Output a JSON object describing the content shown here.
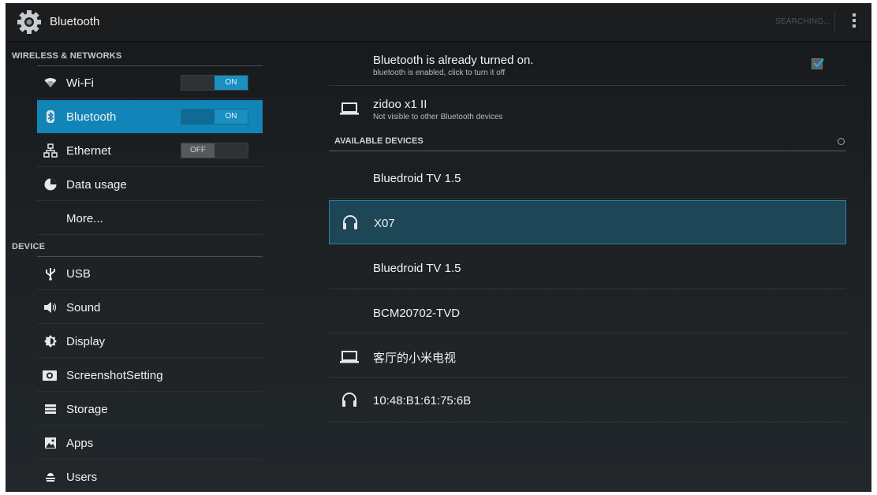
{
  "app": {
    "title": "Bluetooth"
  },
  "actionbar": {
    "status": "SEARCHING..."
  },
  "left": {
    "wireless_header": "WIRELESS & NETWORKS",
    "device_header": "DEVICE",
    "wifi": {
      "label": "Wi-Fi",
      "toggle": "ON"
    },
    "bluetooth": {
      "label": "Bluetooth",
      "toggle": "ON"
    },
    "ethernet": {
      "label": "Ethernet",
      "toggle": "OFF"
    },
    "data_usage": "Data usage",
    "more": "More...",
    "usb": "USB",
    "sound": "Sound",
    "display": "Display",
    "screenshot": "ScreenshotSetting",
    "storage": "Storage",
    "apps": "Apps",
    "users": "Users"
  },
  "right": {
    "bt_status": {
      "title": "Bluetooth is already turned on.",
      "subtitle": "bluetooth is enabled, click to turn it off",
      "checked": true
    },
    "this_device": {
      "name": "zidoo x1 II",
      "subtitle": "Not visible to other Bluetooth devices",
      "icon": "laptop-icon"
    },
    "available_header": "AVAILABLE DEVICES",
    "devices": [
      {
        "name": "Bluedroid TV 1.5",
        "icon": ""
      },
      {
        "name": "X07",
        "icon": "headphones-icon",
        "selected": true
      },
      {
        "name": "Bluedroid TV 1.5",
        "icon": ""
      },
      {
        "name": "BCM20702-TVD",
        "icon": ""
      },
      {
        "name": "客厅的小米电视",
        "icon": "laptop-icon"
      },
      {
        "name": "10:48:B1:61:75:6B",
        "icon": "headphones-icon"
      }
    ]
  },
  "colors": {
    "accent": "#1285b8",
    "selected_row": "#1d4656",
    "background": "#1d2124"
  }
}
